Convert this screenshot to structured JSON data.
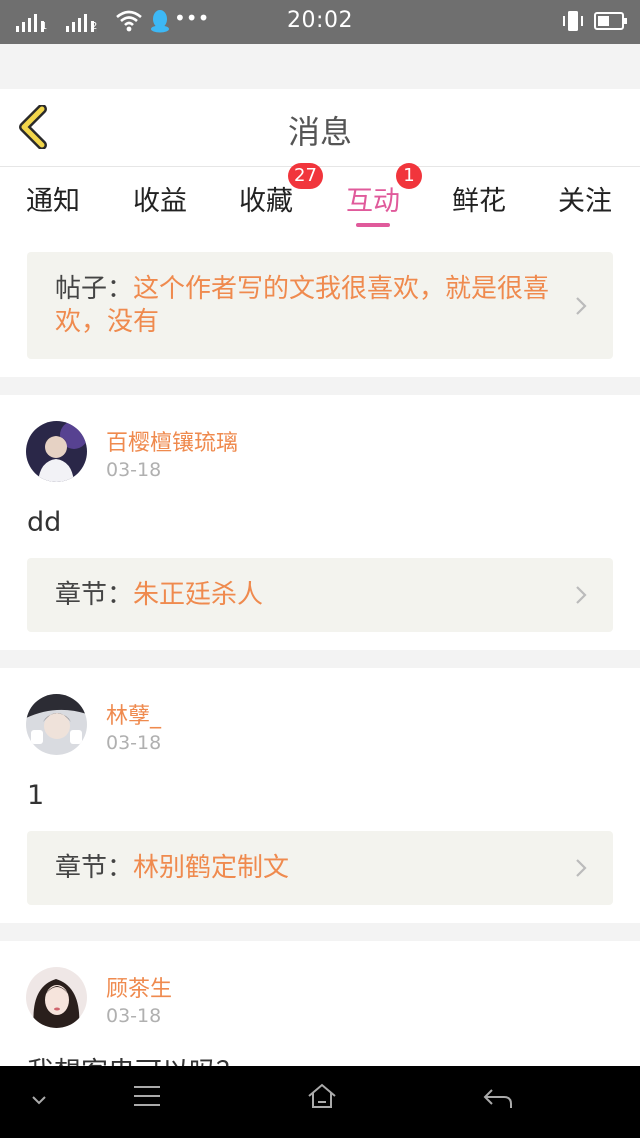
{
  "status_bar": {
    "time": "20:02",
    "sim1": "1",
    "sim2": "2",
    "more": "•••"
  },
  "header": {
    "title": "消息"
  },
  "tabs": [
    {
      "label": "通知"
    },
    {
      "label": "收益"
    },
    {
      "label": "收藏",
      "badge": "27"
    },
    {
      "label": "互动",
      "badge": "1",
      "active": true
    },
    {
      "label": "鲜花"
    },
    {
      "label": "关注"
    }
  ],
  "top_card": {
    "label": "帖子：",
    "text": "这个作者写的文我很喜欢，就是很喜欢，没有"
  },
  "messages": [
    {
      "user": "百樱檀镶琉璃",
      "date": "03-18",
      "content": "dd",
      "ref_label": "章节：",
      "ref_title": "朱正廷杀人"
    },
    {
      "user": "林孽_",
      "date": "03-18",
      "content": "1",
      "ref_label": "章节：",
      "ref_title": "林别鹤定制文"
    },
    {
      "user": "顾茶生",
      "date": "03-18",
      "content": "我想客串可以吗？"
    }
  ],
  "colors": {
    "accent": "#e05a9b",
    "link": "#ef8a4e",
    "badge": "#f1353c",
    "back_arrow": "#f2d64b"
  }
}
